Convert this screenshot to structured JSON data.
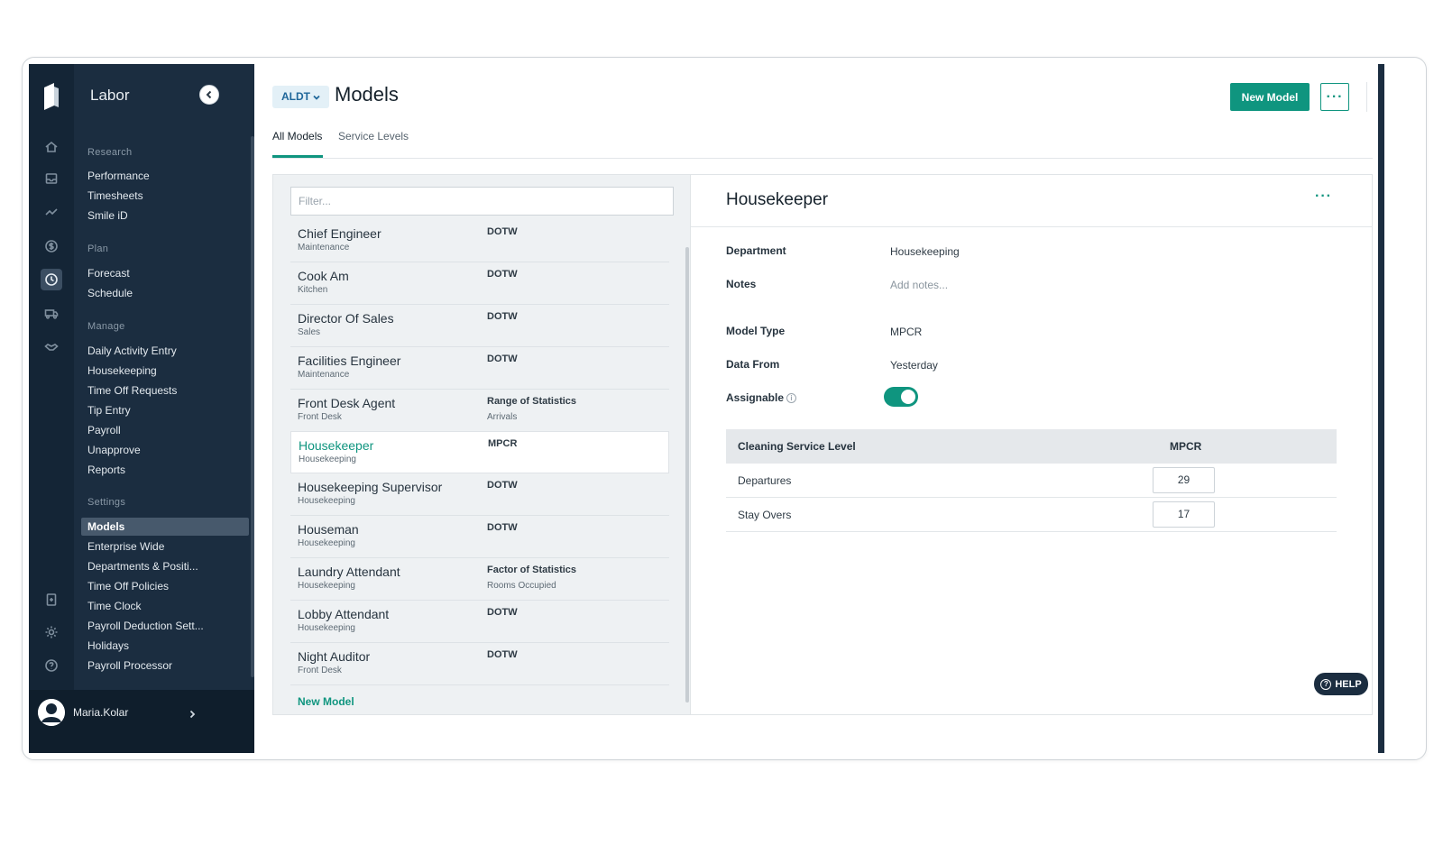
{
  "sidebar": {
    "app_title": "Labor",
    "sections": {
      "research": "Research",
      "plan": "Plan",
      "manage": "Manage",
      "settings": "Settings"
    },
    "research_items": [
      "Performance",
      "Timesheets",
      "Smile iD"
    ],
    "plan_items": [
      "Forecast",
      "Schedule"
    ],
    "manage_items": [
      "Daily Activity Entry",
      "Housekeeping",
      "Time Off Requests",
      "Tip Entry",
      "Payroll",
      "Unapprove",
      "Reports"
    ],
    "settings_items": [
      "Models",
      "Enterprise Wide",
      "Departments & Positi...",
      "Time Off Policies",
      "Time Clock",
      "Payroll Deduction Sett...",
      "Holidays",
      "Payroll Processor"
    ],
    "selected_item": "Models",
    "user_name": "Maria.Kolar"
  },
  "rail_icons": [
    "home-icon",
    "inbox-icon",
    "trend-icon",
    "dollar-icon",
    "clock-icon",
    "truck-icon",
    "handshake-icon",
    "badge-icon",
    "gear-icon",
    "question-icon"
  ],
  "header": {
    "property_selector": "ALDT",
    "title": "Models",
    "new_model_label": "New Model",
    "more_label": "···"
  },
  "tabs": [
    {
      "label": "All Models",
      "active": true
    },
    {
      "label": "Service Levels",
      "active": false
    }
  ],
  "list": {
    "filter_placeholder": "Filter...",
    "rows": [
      {
        "name": "Chief Engineer",
        "dept": "Maintenance",
        "type": "DOTW",
        "sub": ""
      },
      {
        "name": "Cook Am",
        "dept": "Kitchen",
        "type": "DOTW",
        "sub": ""
      },
      {
        "name": "Director Of Sales",
        "dept": "Sales",
        "type": "DOTW",
        "sub": ""
      },
      {
        "name": "Facilities Engineer",
        "dept": "Maintenance",
        "type": "DOTW",
        "sub": ""
      },
      {
        "name": "Front Desk Agent",
        "dept": "Front Desk",
        "type": "Range of Statistics",
        "sub": "Arrivals"
      },
      {
        "name": "Housekeeper",
        "dept": "Housekeeping",
        "type": "MPCR",
        "sub": ""
      },
      {
        "name": "Housekeeping Supervisor",
        "dept": "Housekeeping",
        "type": "DOTW",
        "sub": ""
      },
      {
        "name": "Houseman",
        "dept": "Housekeeping",
        "type": "DOTW",
        "sub": ""
      },
      {
        "name": "Laundry Attendant",
        "dept": "Housekeeping",
        "type": "Factor of Statistics",
        "sub": "Rooms Occupied"
      },
      {
        "name": "Lobby Attendant",
        "dept": "Housekeeping",
        "type": "DOTW",
        "sub": ""
      },
      {
        "name": "Night Auditor",
        "dept": "Front Desk",
        "type": "DOTW",
        "sub": ""
      }
    ],
    "selected_index": 5,
    "new_model_link": "New Model"
  },
  "detail": {
    "title": "Housekeeper",
    "more_label": "···",
    "fields": {
      "department_label": "Department",
      "department_value": "Housekeeping",
      "notes_label": "Notes",
      "notes_placeholder": "Add notes...",
      "model_type_label": "Model Type",
      "model_type_value": "MPCR",
      "data_from_label": "Data From",
      "data_from_value": "Yesterday",
      "assignable_label": "Assignable",
      "assignable_on": true
    },
    "service_table": {
      "col1": "Cleaning Service Level",
      "col2": "MPCR",
      "rows": [
        {
          "label": "Departures",
          "value": "29"
        },
        {
          "label": "Stay Overs",
          "value": "17"
        }
      ]
    }
  },
  "help_label": "HELP",
  "colors": {
    "accent": "#0f957f",
    "sidebar_bg": "#1b2d40",
    "rail_bg": "#142536"
  }
}
